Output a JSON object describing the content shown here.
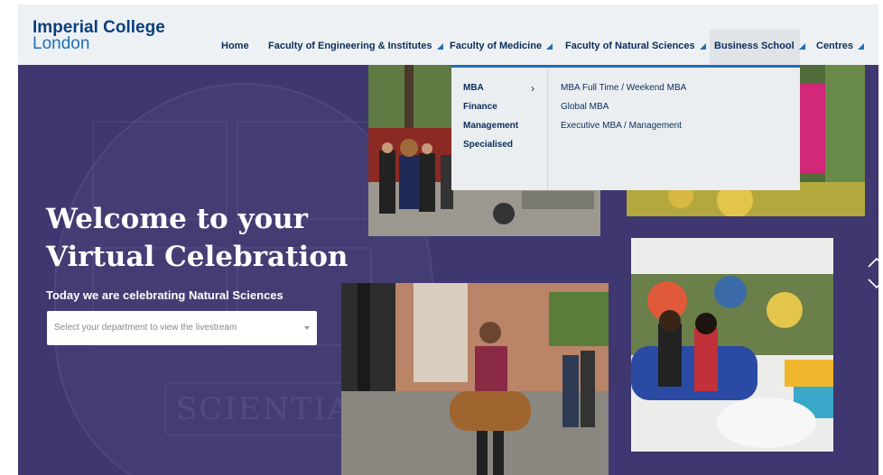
{
  "logo": {
    "line1": "Imperial College",
    "line2": "London"
  },
  "nav": {
    "items": [
      {
        "label": "Home",
        "caret": false
      },
      {
        "label": "Faculty of Engineering & Institutes",
        "caret": true
      },
      {
        "label": "Faculty of Medicine",
        "caret": true
      },
      {
        "label": "Faculty of Natural Sciences",
        "caret": true
      },
      {
        "label": "Business School",
        "caret": true
      },
      {
        "label": "Centres",
        "caret": true
      }
    ],
    "active": "Business School"
  },
  "hero": {
    "title_line1": "Welcome to your",
    "title_line2": "Virtual Celebration",
    "subtitle": "Today we are celebrating Natural Sciences",
    "crest_motto": "SCIENTIA"
  },
  "department_select": {
    "placeholder": "Select your department to view the livestream"
  },
  "mega_menu": {
    "categories": [
      "MBA",
      "Finance",
      "Management",
      "Specialised"
    ],
    "active_category": "MBA",
    "submenu": [
      "MBA Full Time / Weekend MBA",
      "Global MBA",
      "Executive MBA / Management"
    ]
  },
  "colors": {
    "hero_bg": "#3e3770",
    "header_bg": "#eef1f4",
    "brand_navy": "#0a2d5c",
    "brand_blue": "#1d6fb8"
  },
  "icons": [
    "chevron-right-icon",
    "caret-icon",
    "arrow-up-icon",
    "arrow-down-icon",
    "dropdown-arrow-icon"
  ]
}
